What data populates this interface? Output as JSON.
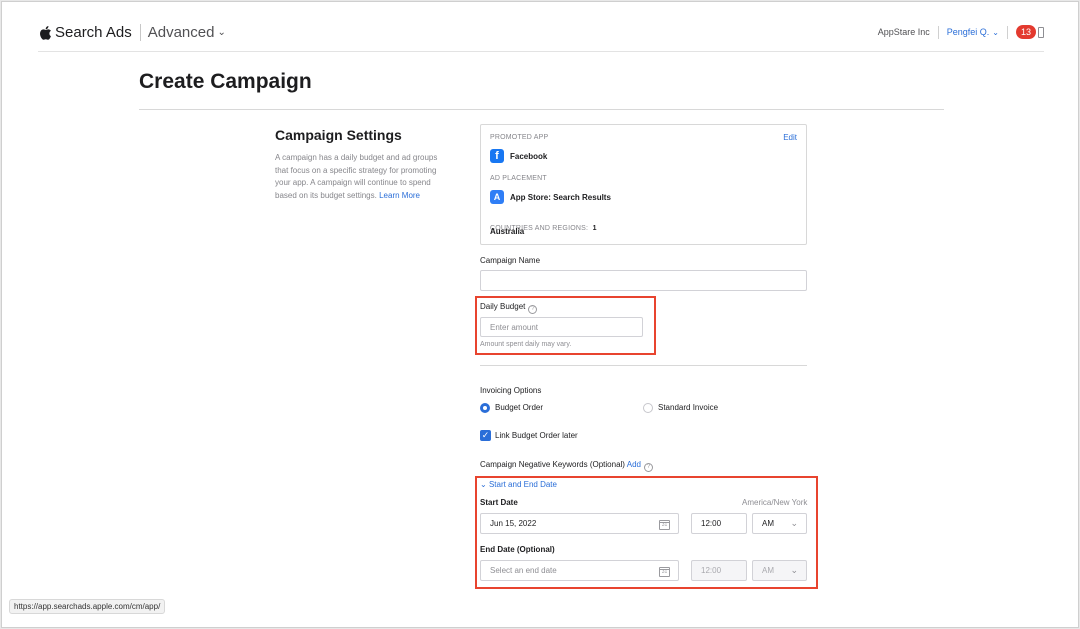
{
  "header": {
    "brand": "Search Ads",
    "mode": "Advanced",
    "org": "AppStare Inc",
    "user": "Pengfei Q.",
    "notification_count": "13"
  },
  "page": {
    "title": "Create Campaign"
  },
  "settings": {
    "heading": "Campaign Settings",
    "description": "A campaign has a daily budget and ad groups that focus on a specific strategy for promoting your app. A campaign will continue to spend based on its budget settings.",
    "learn_more": "Learn More"
  },
  "summary": {
    "promoted_app_caption": "PROMOTED APP",
    "edit_label": "Edit",
    "app_name": "Facebook",
    "ad_placement_caption": "AD PLACEMENT",
    "ad_placement": "App Store: Search Results",
    "countries_caption": "COUNTRIES AND REGIONS:",
    "countries_count": "1",
    "countries": "Australia"
  },
  "campaign_name": {
    "label": "Campaign Name",
    "value": ""
  },
  "daily_budget": {
    "label": "Daily Budget",
    "placeholder": "Enter amount",
    "hint": "Amount spent daily may vary."
  },
  "invoicing": {
    "label": "Invoicing Options",
    "options": [
      "Budget Order",
      "Standard Invoice"
    ],
    "selected": "Budget Order",
    "link_later": "Link Budget Order later"
  },
  "negative_keywords": {
    "label": "Campaign Negative Keywords (Optional)",
    "add_label": "Add"
  },
  "dates": {
    "section_toggle": "Start and End Date",
    "start_label": "Start Date",
    "timezone": "America/New York",
    "start_date": "Jun 15, 2022",
    "start_time": "12:00",
    "start_ampm": "AM",
    "end_label": "End Date (Optional)",
    "end_placeholder": "Select an end date",
    "end_time": "12:00",
    "end_ampm": "AM"
  },
  "status_bar": {
    "url": "https://app.searchads.apple.com/cm/app/"
  },
  "colors": {
    "accent": "#2a6ed8",
    "highlight": "#e8442f",
    "badge": "#e33a2f"
  }
}
